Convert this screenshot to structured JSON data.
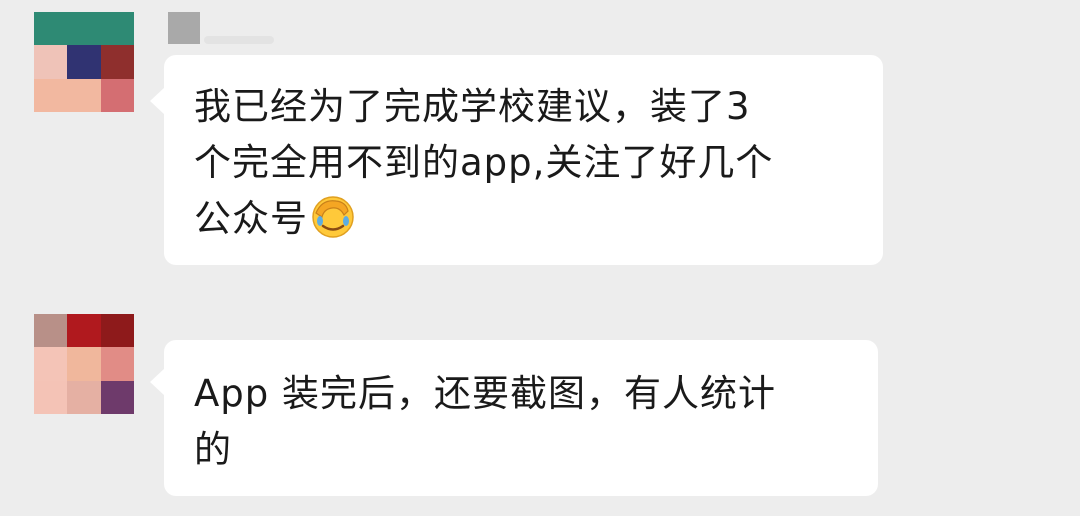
{
  "conversation": {
    "messages": [
      {
        "avatar": {
          "description": "pixelated-avatar",
          "tiles": [
            "#2E8A74",
            "#2E8A74",
            "#2E8A74",
            "#EFC3B8",
            "#303372",
            "#8F2F2D",
            "#F2B8A0",
            "#F2B8A0",
            "#D46E72"
          ]
        },
        "lines": [
          "我已经为了完成学校建议，装了3",
          "个完全用不到的app,关注了好几个",
          "公众号"
        ],
        "emoji": "face-palm-emoji"
      },
      {
        "avatar": {
          "description": "pixelated-avatar",
          "tiles": [
            "#B89088",
            "#B0191E",
            "#8E1A1B",
            "#F4C4B7",
            "#F0B79C",
            "#E18C86",
            "#F4C3B6",
            "#E5B0A3",
            "#6E3A6B"
          ]
        },
        "lines": [
          "App 装完后，还要截图，有人统计",
          "的"
        ]
      }
    ]
  },
  "colors": {
    "background": "#EDEDED",
    "bubble": "#FFFFFF",
    "text": "#1A1A1A",
    "name_placeholder": "#A9A9A9"
  }
}
